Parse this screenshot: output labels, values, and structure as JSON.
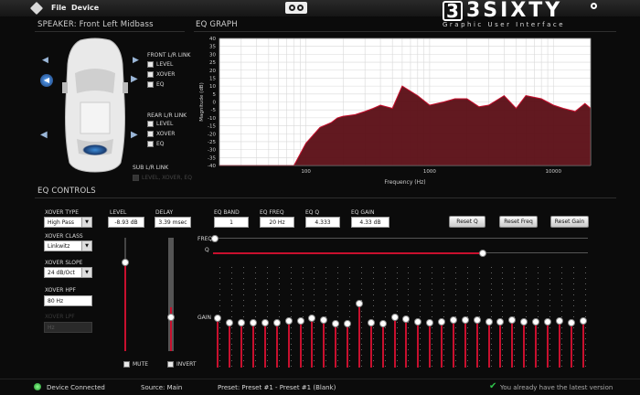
{
  "menu": {
    "file": "File",
    "device": "Device"
  },
  "logo": {
    "brand": "3SIXTY",
    "subtitle": "Graphic User Interface",
    "mark": "3"
  },
  "speaker": {
    "heading": "SPEAKER:",
    "name": "Front Left Midbass"
  },
  "front_link": {
    "title": "FRONT L/R LINK",
    "items": [
      "LEVEL",
      "XOVER",
      "EQ"
    ]
  },
  "rear_link": {
    "title": "REAR L/R LINK",
    "items": [
      "LEVEL",
      "XOVER",
      "EQ"
    ]
  },
  "sub_link": {
    "title": "SUB L/R LINK",
    "item": "LEVEL, XOVER, EQ"
  },
  "eq_graph": {
    "heading": "EQ GRAPH",
    "ylabel": "Magnitude (dB)",
    "xlabel": "Frequency (Hz)",
    "yticks": [
      "40",
      "35",
      "30",
      "25",
      "20",
      "15",
      "10",
      "5",
      "0",
      "-5",
      "-10",
      "-15",
      "-20",
      "-25",
      "-30",
      "-35",
      "-40"
    ],
    "xticks": [
      "100",
      "1000",
      "10000"
    ]
  },
  "chart_data": {
    "type": "area",
    "xlabel": "Frequency (Hz)",
    "ylabel": "Magnitude (dB)",
    "xscale": "log",
    "xlim": [
      20,
      20000
    ],
    "ylim": [
      -40,
      40
    ],
    "grid": true,
    "x": [
      20,
      80,
      100,
      130,
      160,
      180,
      200,
      250,
      300,
      350,
      400,
      500,
      600,
      800,
      1000,
      1300,
      1600,
      2000,
      2500,
      3000,
      4000,
      5000,
      6000,
      8000,
      10000,
      12000,
      15000,
      18000,
      20000
    ],
    "values": [
      -45,
      -40,
      -26,
      -16,
      -13,
      -10,
      -9,
      -8,
      -6,
      -4,
      -2,
      -4,
      10,
      4,
      -2,
      0,
      2,
      2,
      -3,
      -2,
      4,
      -4,
      4,
      2,
      -2,
      -4,
      -6,
      -1,
      -4
    ]
  },
  "eq_controls": {
    "heading": "EQ CONTROLS"
  },
  "xover": {
    "type_label": "XOVER TYPE",
    "type_value": "High Pass",
    "class_label": "XOVER CLASS",
    "class_value": "Linkwitz",
    "slope_label": "XOVER SLOPE",
    "slope_value": "24 dB/Oct",
    "hpf_label": "XOVER HPF",
    "hpf_value": "80 Hz",
    "lpf_label": "XOVER LPF",
    "lpf_value": "Hz"
  },
  "level": {
    "label": "LEVEL",
    "value": "-8.93 dB",
    "mute": "MUTE",
    "fraction": 0.22
  },
  "delay": {
    "label": "DELAY",
    "value": "3.39 msec",
    "invert": "INVERT",
    "fraction": 0.36
  },
  "eq_band": {
    "label": "EQ BAND",
    "value": "1"
  },
  "eq_freq": {
    "label": "EQ FREQ",
    "value": "20 Hz"
  },
  "eq_q": {
    "label": "EQ Q",
    "value": "4.333"
  },
  "eq_gain": {
    "label": "EQ GAIN",
    "value": "4.33 dB"
  },
  "buttons": {
    "reset_q": "Reset Q",
    "reset_freq": "Reset Freq",
    "reset_gain": "Reset Gain"
  },
  "sliders": {
    "freq": "FREQ",
    "q": "Q",
    "gain": "GAIN",
    "freq_fraction": 0.0,
    "q_fraction": 0.72
  },
  "band_gains": [
    0.26,
    0.12,
    0.12,
    0.12,
    0.12,
    0.12,
    0.17,
    0.17,
    0.28,
    0.21,
    0.08,
    0.1,
    0.76,
    0.13,
    0.08,
    0.3,
    0.23,
    0.16,
    0.12,
    0.16,
    0.2,
    0.2,
    0.2,
    0.16,
    0.16,
    0.22,
    0.16,
    0.16,
    0.14,
    0.18,
    0.12,
    0.18
  ],
  "status": {
    "connected": "Device Connected",
    "source": "Source: Main",
    "preset": "Preset: Preset #1 - Preset #1 (Blank)",
    "update": "You already have the latest version"
  },
  "colors": {
    "accent": "#c8102e",
    "fill": "#5a0d14",
    "status_green": "#2fc24a"
  }
}
